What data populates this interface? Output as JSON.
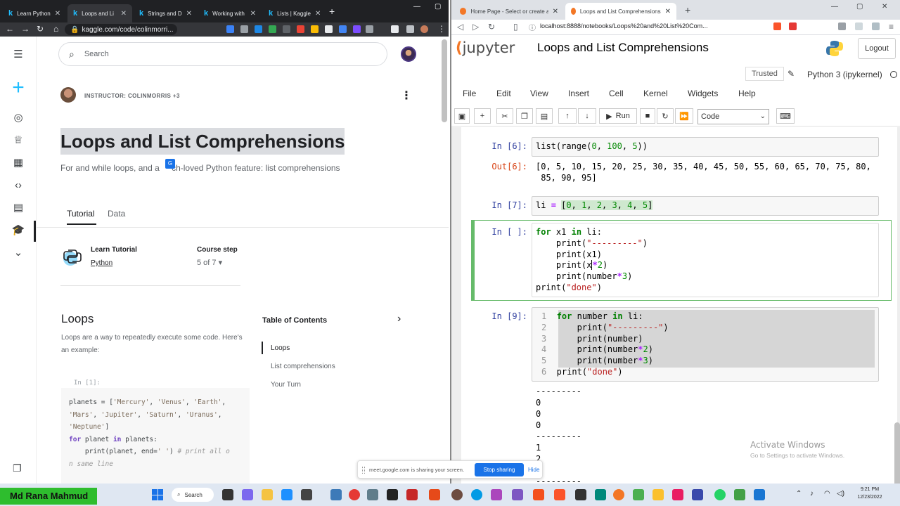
{
  "left_browser": {
    "tabs": [
      {
        "label": "Learn Python"
      },
      {
        "label": "Loops and Li"
      },
      {
        "label": "Strings and D"
      },
      {
        "label": "Working with"
      },
      {
        "label": "Lists | Kaggle"
      }
    ],
    "url": "kaggle.com/code/colinmorri..."
  },
  "kaggle": {
    "search_placeholder": "Search",
    "instructor": "INSTRUCTOR: COLINMORRIS +3",
    "title": "Loops and List Comprehensions",
    "subtitle": "For and while loops, and a much-loved Python feature: list comprehensions",
    "subtitle_part1": "For and while loops, and a ",
    "subtitle_part2": "ch-loved Python feature: list comprehensions",
    "tabs": [
      "Tutorial",
      "Data"
    ],
    "learn_tutorial_label": "Learn Tutorial",
    "learn_tutorial_link": "Python",
    "course_step_label": "Course step",
    "course_step_value": "5 of 7 ▾",
    "section_heading": "Loops",
    "section_text": "Loops are a way to repeatedly execute some code. Here's an example:",
    "toc_heading": "Table of Contents",
    "toc_items": [
      "Loops",
      "List comprehensions",
      "Your Turn"
    ],
    "code_prompt": "In [1]:"
  },
  "right_browser": {
    "tabs": [
      {
        "label": "Home Page - Select or create a notebook"
      },
      {
        "label": "Loops and List Comprehensions"
      }
    ],
    "url": "localhost:8888/notebooks/Loops%20and%20List%20Com..."
  },
  "jupyter": {
    "logo_text": "jupyter",
    "notebook_title": "Loops and List Comprehensions",
    "logout": "Logout",
    "trusted": "Trusted",
    "kernel": "Python 3 (ipykernel)",
    "menu": [
      "File",
      "Edit",
      "View",
      "Insert",
      "Cell",
      "Kernel",
      "Widgets",
      "Help"
    ],
    "run_label": "Run",
    "cell_type": "Code",
    "cells": {
      "in6_prompt": "In [6]:",
      "out6_prompt": "Out[6]:",
      "out6_line1": "[0, 5, 10, 15, 20, 25, 30, 35, 40, 45, 50, 55, 60, 65, 70, 75, 80,",
      "out6_line2": " 85, 90, 95]",
      "in7_prompt": "In [7]:",
      "in_empty_prompt": "In [ ]:",
      "in9_prompt": "In [9]:",
      "output9": [
        "---------",
        "0",
        "0",
        "0",
        "---------",
        "1",
        "2",
        "",
        "---------"
      ]
    },
    "activate_title": "Activate Windows",
    "activate_sub": "Go to Settings to activate Windows."
  },
  "share_bar": {
    "text": "meet.google.com is sharing your screen.",
    "stop": "Stop sharing",
    "hide": "Hide"
  },
  "taskbar": {
    "name_badge": "Md Rana Mahmud",
    "search": "Search",
    "time": "9:21 PM",
    "date": "12/23/2022"
  }
}
